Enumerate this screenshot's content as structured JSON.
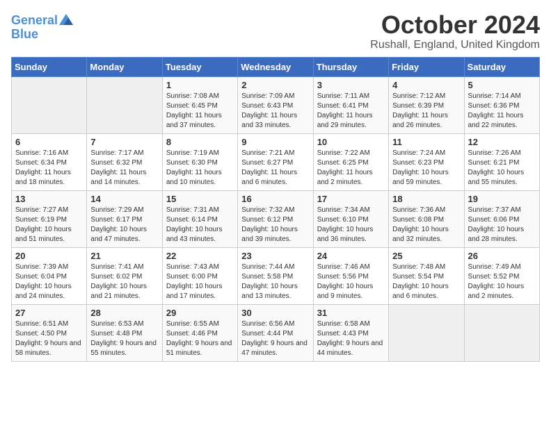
{
  "logo": {
    "line1": "General",
    "line2": "Blue"
  },
  "title": "October 2024",
  "subtitle": "Rushall, England, United Kingdom",
  "days_of_week": [
    "Sunday",
    "Monday",
    "Tuesday",
    "Wednesday",
    "Thursday",
    "Friday",
    "Saturday"
  ],
  "weeks": [
    [
      {
        "day": "",
        "detail": ""
      },
      {
        "day": "",
        "detail": ""
      },
      {
        "day": "1",
        "detail": "Sunrise: 7:08 AM\nSunset: 6:45 PM\nDaylight: 11 hours and 37 minutes."
      },
      {
        "day": "2",
        "detail": "Sunrise: 7:09 AM\nSunset: 6:43 PM\nDaylight: 11 hours and 33 minutes."
      },
      {
        "day": "3",
        "detail": "Sunrise: 7:11 AM\nSunset: 6:41 PM\nDaylight: 11 hours and 29 minutes."
      },
      {
        "day": "4",
        "detail": "Sunrise: 7:12 AM\nSunset: 6:39 PM\nDaylight: 11 hours and 26 minutes."
      },
      {
        "day": "5",
        "detail": "Sunrise: 7:14 AM\nSunset: 6:36 PM\nDaylight: 11 hours and 22 minutes."
      }
    ],
    [
      {
        "day": "6",
        "detail": "Sunrise: 7:16 AM\nSunset: 6:34 PM\nDaylight: 11 hours and 18 minutes."
      },
      {
        "day": "7",
        "detail": "Sunrise: 7:17 AM\nSunset: 6:32 PM\nDaylight: 11 hours and 14 minutes."
      },
      {
        "day": "8",
        "detail": "Sunrise: 7:19 AM\nSunset: 6:30 PM\nDaylight: 11 hours and 10 minutes."
      },
      {
        "day": "9",
        "detail": "Sunrise: 7:21 AM\nSunset: 6:27 PM\nDaylight: 11 hours and 6 minutes."
      },
      {
        "day": "10",
        "detail": "Sunrise: 7:22 AM\nSunset: 6:25 PM\nDaylight: 11 hours and 2 minutes."
      },
      {
        "day": "11",
        "detail": "Sunrise: 7:24 AM\nSunset: 6:23 PM\nDaylight: 10 hours and 59 minutes."
      },
      {
        "day": "12",
        "detail": "Sunrise: 7:26 AM\nSunset: 6:21 PM\nDaylight: 10 hours and 55 minutes."
      }
    ],
    [
      {
        "day": "13",
        "detail": "Sunrise: 7:27 AM\nSunset: 6:19 PM\nDaylight: 10 hours and 51 minutes."
      },
      {
        "day": "14",
        "detail": "Sunrise: 7:29 AM\nSunset: 6:17 PM\nDaylight: 10 hours and 47 minutes."
      },
      {
        "day": "15",
        "detail": "Sunrise: 7:31 AM\nSunset: 6:14 PM\nDaylight: 10 hours and 43 minutes."
      },
      {
        "day": "16",
        "detail": "Sunrise: 7:32 AM\nSunset: 6:12 PM\nDaylight: 10 hours and 39 minutes."
      },
      {
        "day": "17",
        "detail": "Sunrise: 7:34 AM\nSunset: 6:10 PM\nDaylight: 10 hours and 36 minutes."
      },
      {
        "day": "18",
        "detail": "Sunrise: 7:36 AM\nSunset: 6:08 PM\nDaylight: 10 hours and 32 minutes."
      },
      {
        "day": "19",
        "detail": "Sunrise: 7:37 AM\nSunset: 6:06 PM\nDaylight: 10 hours and 28 minutes."
      }
    ],
    [
      {
        "day": "20",
        "detail": "Sunrise: 7:39 AM\nSunset: 6:04 PM\nDaylight: 10 hours and 24 minutes."
      },
      {
        "day": "21",
        "detail": "Sunrise: 7:41 AM\nSunset: 6:02 PM\nDaylight: 10 hours and 21 minutes."
      },
      {
        "day": "22",
        "detail": "Sunrise: 7:43 AM\nSunset: 6:00 PM\nDaylight: 10 hours and 17 minutes."
      },
      {
        "day": "23",
        "detail": "Sunrise: 7:44 AM\nSunset: 5:58 PM\nDaylight: 10 hours and 13 minutes."
      },
      {
        "day": "24",
        "detail": "Sunrise: 7:46 AM\nSunset: 5:56 PM\nDaylight: 10 hours and 9 minutes."
      },
      {
        "day": "25",
        "detail": "Sunrise: 7:48 AM\nSunset: 5:54 PM\nDaylight: 10 hours and 6 minutes."
      },
      {
        "day": "26",
        "detail": "Sunrise: 7:49 AM\nSunset: 5:52 PM\nDaylight: 10 hours and 2 minutes."
      }
    ],
    [
      {
        "day": "27",
        "detail": "Sunrise: 6:51 AM\nSunset: 4:50 PM\nDaylight: 9 hours and 58 minutes."
      },
      {
        "day": "28",
        "detail": "Sunrise: 6:53 AM\nSunset: 4:48 PM\nDaylight: 9 hours and 55 minutes."
      },
      {
        "day": "29",
        "detail": "Sunrise: 6:55 AM\nSunset: 4:46 PM\nDaylight: 9 hours and 51 minutes."
      },
      {
        "day": "30",
        "detail": "Sunrise: 6:56 AM\nSunset: 4:44 PM\nDaylight: 9 hours and 47 minutes."
      },
      {
        "day": "31",
        "detail": "Sunrise: 6:58 AM\nSunset: 4:43 PM\nDaylight: 9 hours and 44 minutes."
      },
      {
        "day": "",
        "detail": ""
      },
      {
        "day": "",
        "detail": ""
      }
    ]
  ]
}
